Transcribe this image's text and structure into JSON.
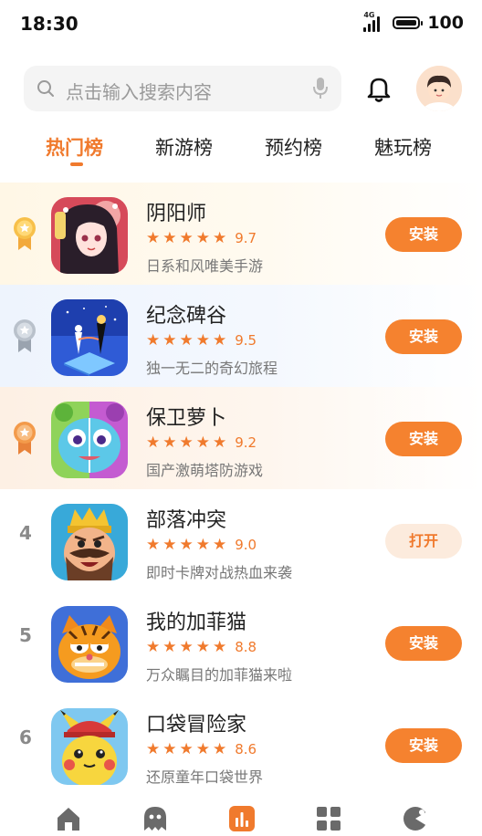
{
  "status": {
    "time": "18:30",
    "network": "4G",
    "battery": "100"
  },
  "search": {
    "placeholder": "点击输入搜索内容"
  },
  "tabs": [
    {
      "label": "热门榜",
      "active": true
    },
    {
      "label": "新游榜",
      "active": false
    },
    {
      "label": "预约榜",
      "active": false
    },
    {
      "label": "魅玩榜",
      "active": false
    }
  ],
  "games": [
    {
      "rank": "1",
      "name": "阴阳师",
      "rating": "9.7",
      "desc": "日系和风唯美手游",
      "action": "安装"
    },
    {
      "rank": "2",
      "name": "纪念碑谷",
      "rating": "9.5",
      "desc": "独一无二的奇幻旅程",
      "action": "安装"
    },
    {
      "rank": "3",
      "name": "保卫萝卜",
      "rating": "9.2",
      "desc": "国产激萌塔防游戏",
      "action": "安装"
    },
    {
      "rank": "4",
      "name": "部落冲突",
      "rating": "9.0",
      "desc": "即时卡牌对战热血来袭",
      "action": "打开"
    },
    {
      "rank": "5",
      "name": "我的加菲猫",
      "rating": "8.8",
      "desc": "万众瞩目的加菲猫来啦",
      "action": "安装"
    },
    {
      "rank": "6",
      "name": "口袋冒险家",
      "rating": "8.6",
      "desc": "还原童年口袋世界",
      "action": "安装"
    }
  ],
  "colors": {
    "accent": "#f07a2d",
    "gold": "#f2a93b",
    "silver": "#a9b1bc",
    "bronze": "#f39a4a"
  },
  "nav": [
    {
      "icon": "home-icon"
    },
    {
      "icon": "ghost-icon"
    },
    {
      "icon": "chart-icon",
      "active": true
    },
    {
      "icon": "grid-icon"
    },
    {
      "icon": "game-icon"
    }
  ]
}
